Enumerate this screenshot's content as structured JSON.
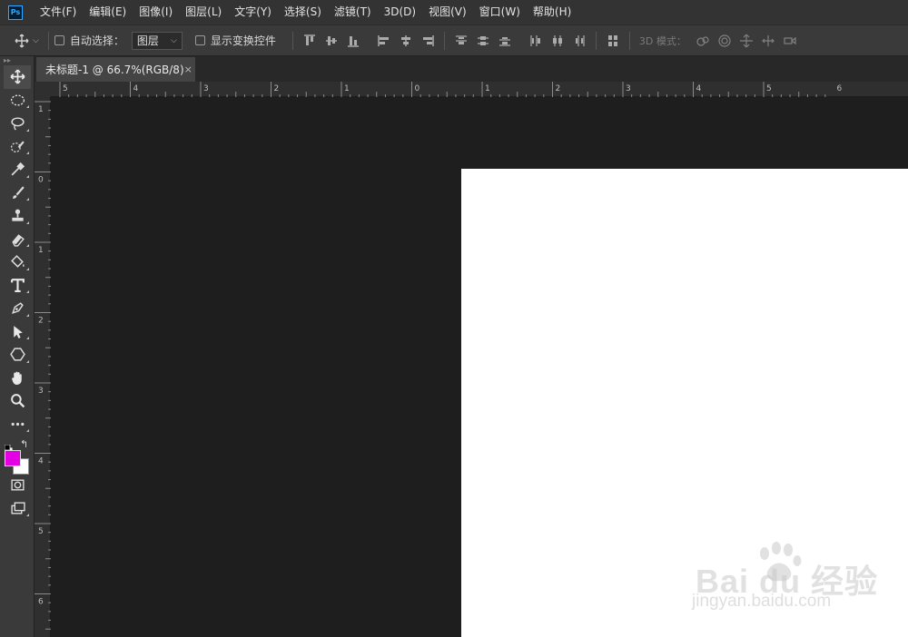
{
  "app": {
    "logo": "Ps"
  },
  "menu": [
    "文件(F)",
    "编辑(E)",
    "图像(I)",
    "图层(L)",
    "文字(Y)",
    "选择(S)",
    "滤镜(T)",
    "3D(D)",
    "视图(V)",
    "窗口(W)",
    "帮助(H)"
  ],
  "options": {
    "auto_select_label": "自动选择：",
    "auto_select_value": "图层",
    "show_transform_label": "显示变换控件",
    "mode3d_label": "3D 模式："
  },
  "document_tab": {
    "title": "未标题-1 @ 66.7%(RGB/8)",
    "close": "×"
  },
  "ruler": {
    "h_labels": [
      "5",
      "4",
      "3",
      "2",
      "1",
      "0",
      "1",
      "2",
      "3",
      "4",
      "5",
      "6"
    ],
    "v_labels": [
      "1",
      "0",
      "1",
      "2",
      "3",
      "4",
      "5",
      "6"
    ]
  },
  "colors": {
    "foreground": "#e300e3",
    "background": "#ffffff",
    "canvas_bg": "#1e1e1e",
    "document": "#ffffff"
  },
  "watermark": {
    "brand": "Bai du 经验",
    "url": "jingyan.baidu.com"
  },
  "icons": [
    "move-tool-icon",
    "marquee-tool-icon",
    "lasso-tool-icon",
    "quick-select-tool-icon",
    "eyedropper-tool-icon",
    "brush-tool-icon",
    "clone-stamp-tool-icon",
    "eraser-tool-icon",
    "paint-bucket-tool-icon",
    "type-tool-icon",
    "pen-tool-icon",
    "path-select-tool-icon",
    "shape-tool-icon",
    "hand-tool-icon",
    "zoom-tool-icon",
    "more-tools-icon"
  ]
}
